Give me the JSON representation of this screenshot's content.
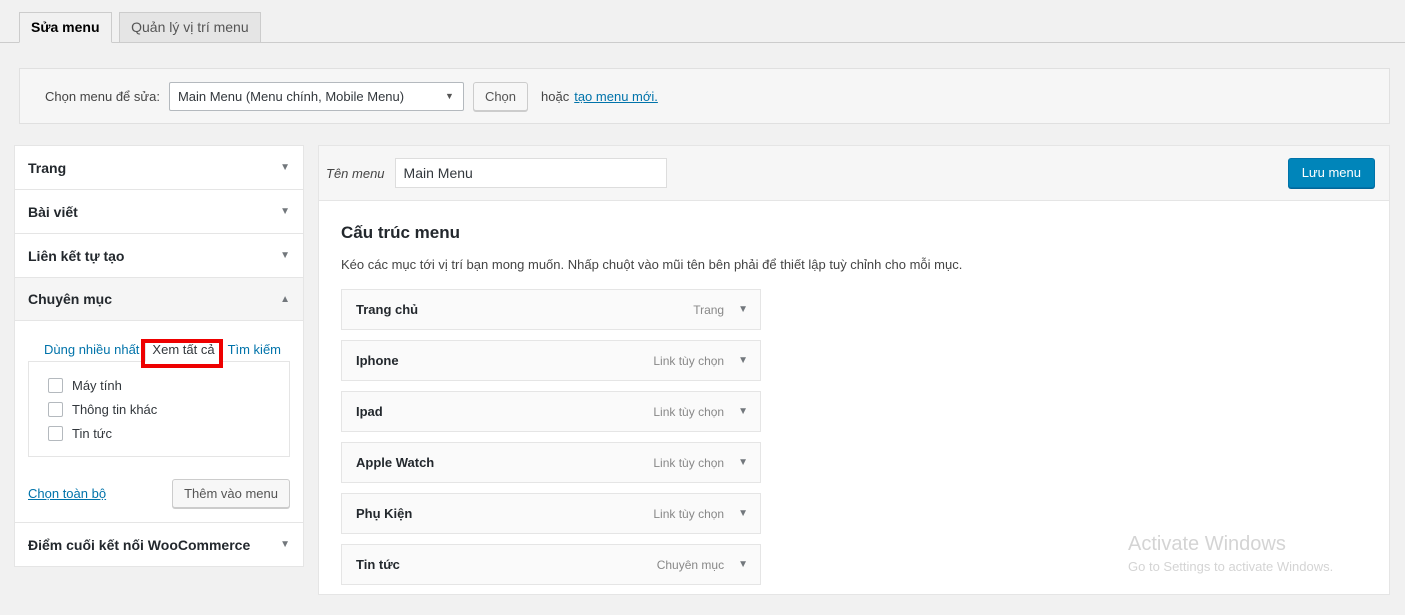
{
  "tabs": [
    {
      "label": "Sửa menu",
      "active": true
    },
    {
      "label": "Quản lý vị trí menu",
      "active": false
    }
  ],
  "select_bar": {
    "label": "Chọn menu để sửa:",
    "selected_menu": "Main Menu (Menu chính, Mobile Menu)",
    "select_button": "Chọn",
    "or_text": "hoặc",
    "create_link": "tạo menu mới.",
    "caret_icon": "chevron-down-icon"
  },
  "sidebar": {
    "panels": [
      {
        "title": "Trang",
        "open": false,
        "arrow": "chevron-down-icon"
      },
      {
        "title": "Bài viết",
        "open": false,
        "arrow": "chevron-down-icon"
      },
      {
        "title": "Liên kết tự tạo",
        "open": false,
        "arrow": "chevron-down-icon"
      },
      {
        "title": "Chuyên mục",
        "open": true,
        "arrow": "chevron-up-icon"
      },
      {
        "title": "Điểm cuối kết nối WooCommerce",
        "open": false,
        "arrow": "chevron-down-icon"
      }
    ],
    "category_panel": {
      "inner_tabs": [
        {
          "label": "Dùng nhiều nhất",
          "active": false
        },
        {
          "label": "Xem tất cả",
          "active": true,
          "highlighted": true
        },
        {
          "label": "Tìm kiếm",
          "active": false
        }
      ],
      "checkboxes": [
        {
          "label": "Máy tính",
          "checked": false
        },
        {
          "label": "Thông tin khác",
          "checked": false
        },
        {
          "label": "Tin tức",
          "checked": false
        }
      ],
      "select_all_link": "Chọn toàn bộ",
      "add_button": "Thêm vào menu"
    }
  },
  "main": {
    "menu_name_label": "Tên menu",
    "menu_name_value": "Main Menu",
    "save_button": "Lưu menu",
    "structure_title": "Cấu trúc menu",
    "structure_desc": "Kéo các mục tới vị trí bạn mong muốn. Nhấp chuột vào mũi tên bên phải để thiết lập tuỳ chỉnh cho mỗi mục.",
    "menu_items": [
      {
        "title": "Trang chủ",
        "type": "Trang",
        "arrow": "chevron-down-icon"
      },
      {
        "title": "Iphone",
        "type": "Link tùy chọn",
        "arrow": "chevron-down-icon"
      },
      {
        "title": "Ipad",
        "type": "Link tùy chọn",
        "arrow": "chevron-down-icon"
      },
      {
        "title": "Apple Watch",
        "type": "Link tùy chọn",
        "arrow": "chevron-down-icon"
      },
      {
        "title": "Phụ Kiện",
        "type": "Link tùy chọn",
        "arrow": "chevron-down-icon"
      },
      {
        "title": "Tin tức",
        "type": "Chuyên mục",
        "arrow": "chevron-down-icon"
      }
    ]
  },
  "watermark": {
    "title": "Activate Windows",
    "subtitle": "Go to Settings to activate Windows."
  },
  "colors": {
    "accent": "#0073aa",
    "primary_button": "#0085ba",
    "highlight_box": "#ee0000",
    "page_bg": "#f1f1f1"
  }
}
